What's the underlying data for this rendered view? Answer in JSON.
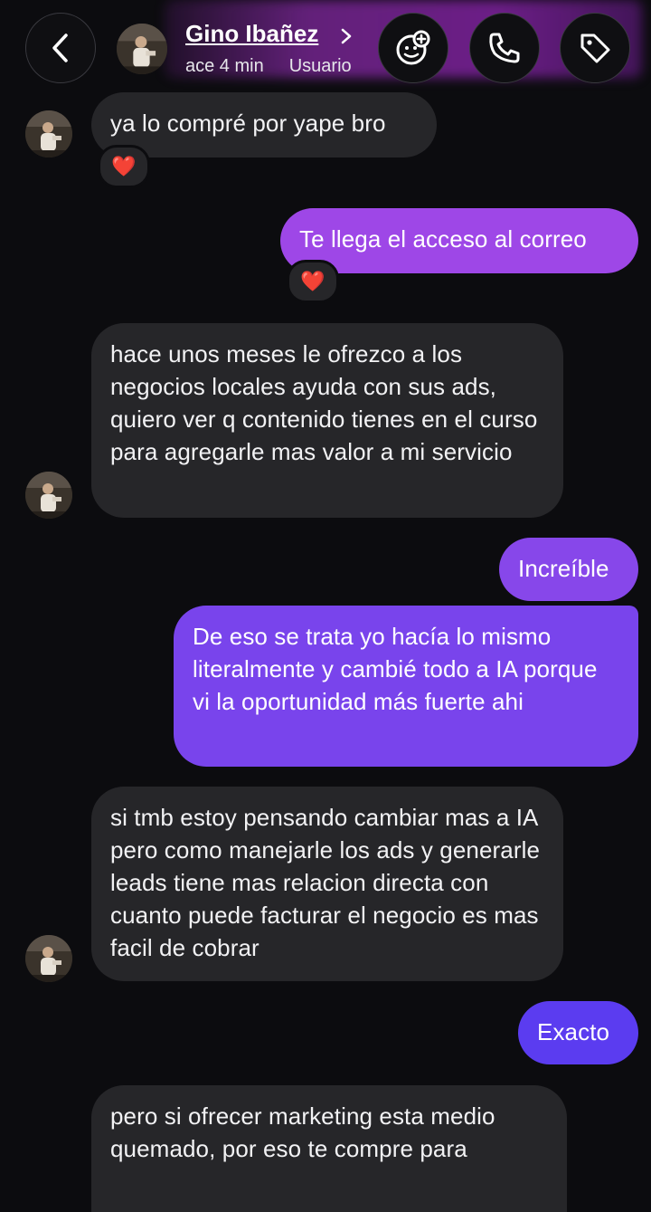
{
  "header": {
    "contact_name": "Gino Ibañez",
    "active_status": "ace 4 min",
    "subtitle": "Usuario",
    "icons": {
      "back": "chevron-left-icon",
      "effects": "sticker-face-icon",
      "call": "phone-icon",
      "tag": "tag-icon",
      "name_chevron": "chevron-right-icon"
    }
  },
  "colors": {
    "background": "#0c0c0f",
    "incoming_bubble": "#262629",
    "outgoing_top": "#a346e6",
    "outgoing_bottom": "#5a3cf0",
    "header_glow": "#b040d8"
  },
  "messages": [
    {
      "direction": "in",
      "text": "ya lo compré por yape bro",
      "reaction": "❤️"
    },
    {
      "direction": "out",
      "text": "Te llega el acceso al correo",
      "reaction": "❤️"
    },
    {
      "direction": "in",
      "text": "hace unos meses le ofrezco a los negocios locales ayuda con sus ads, quiero ver q contenido tienes en el curso para agregarle mas valor a mi servicio"
    },
    {
      "direction": "out",
      "text": "Increíble"
    },
    {
      "direction": "out",
      "text": "De eso se trata yo hacía lo mismo literalmente y cambié todo a IA porque vi la oportunidad más fuerte ahi"
    },
    {
      "direction": "in",
      "text": "si tmb estoy pensando cambiar mas a IA pero como manejarle los ads y generarle leads tiene mas relacion directa con cuanto puede facturar el negocio es mas facil de cobrar"
    },
    {
      "direction": "out",
      "text": "Exacto"
    },
    {
      "direction": "in",
      "text": "pero si ofrecer marketing esta medio quemado, por eso te compre para"
    }
  ]
}
